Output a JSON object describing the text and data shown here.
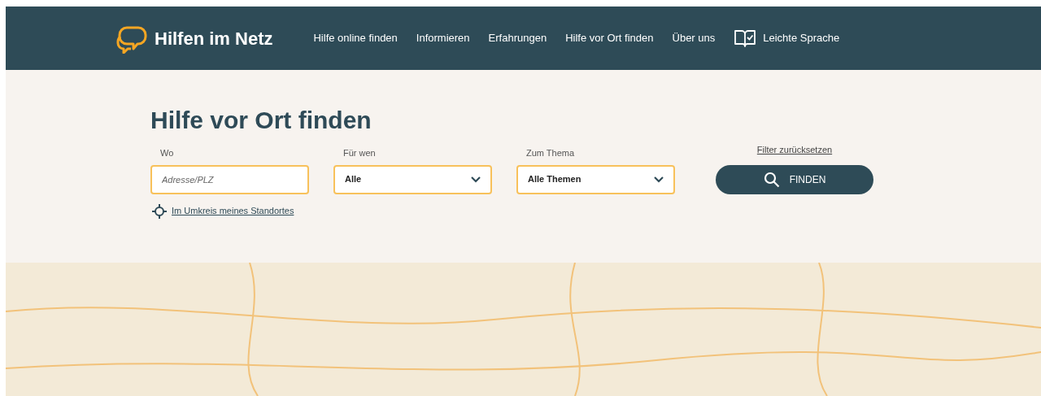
{
  "header": {
    "logo_text": "Hilfen im Netz",
    "nav": [
      {
        "label": "Hilfe online finden",
        "kind": "link"
      },
      {
        "label": "Informieren",
        "kind": "link"
      },
      {
        "label": "Erfahrungen",
        "kind": "link"
      },
      {
        "label": "Hilfe vor Ort finden",
        "kind": "link"
      },
      {
        "label": "Über uns",
        "kind": "link"
      },
      {
        "label": "Leichte Sprache",
        "kind": "book"
      }
    ]
  },
  "search": {
    "title": "Hilfe vor Ort finden",
    "fields": [
      {
        "label": "Wo",
        "kind": "input",
        "placeholder": "Adresse/PLZ"
      },
      {
        "label": "Für wen",
        "kind": "select",
        "value": "Alle"
      },
      {
        "label": "Zum Thema",
        "kind": "select",
        "value": "Alle Themen"
      }
    ],
    "reset_link": "Filter zurücksetzen",
    "button": "FINDEN",
    "location_link": "Im Umkreis meines Standortes"
  }
}
